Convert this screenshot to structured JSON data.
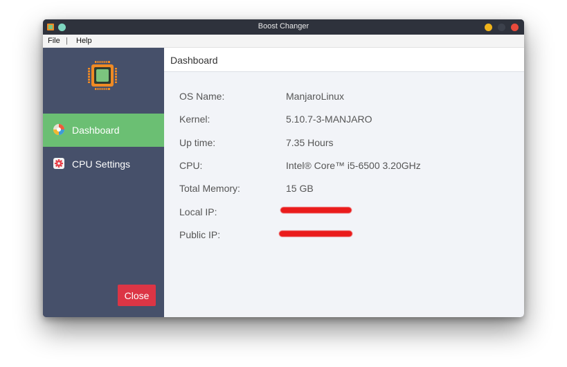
{
  "window": {
    "title": "Boost Changer"
  },
  "menu": {
    "file": "File",
    "separator": "|",
    "help": "Help"
  },
  "sidebar": {
    "logo_icon": "cpu-chip-icon",
    "items": [
      {
        "label": "Dashboard",
        "icon": "dashboard-icon",
        "active": true
      },
      {
        "label": "CPU Settings",
        "icon": "gear-icon",
        "active": false
      }
    ],
    "close_label": "Close"
  },
  "main": {
    "header": "Dashboard",
    "rows": [
      {
        "label": "OS Name:",
        "value": "ManjaroLinux"
      },
      {
        "label": "Kernel:",
        "value": "5.10.7-3-MANJARO"
      },
      {
        "label": "Up time:",
        "value": "7.35 Hours"
      },
      {
        "label": "CPU:",
        "value": "Intel® Core™ i5-6500 3.20GHz"
      },
      {
        "label": "Total Memory:",
        "value": "15 GB"
      },
      {
        "label": "Local IP:",
        "value": ""
      },
      {
        "label": "Public IP:",
        "value": ""
      }
    ]
  },
  "colors": {
    "sidebar_bg": "#46506a",
    "active_item": "#6bbf73",
    "close_button": "#dc3545",
    "redaction": "#ea1b1b",
    "titlebar_minimize": "#f1b41b",
    "titlebar_close": "#e84a3b",
    "titlebar_pin": "#7ed6c0"
  }
}
